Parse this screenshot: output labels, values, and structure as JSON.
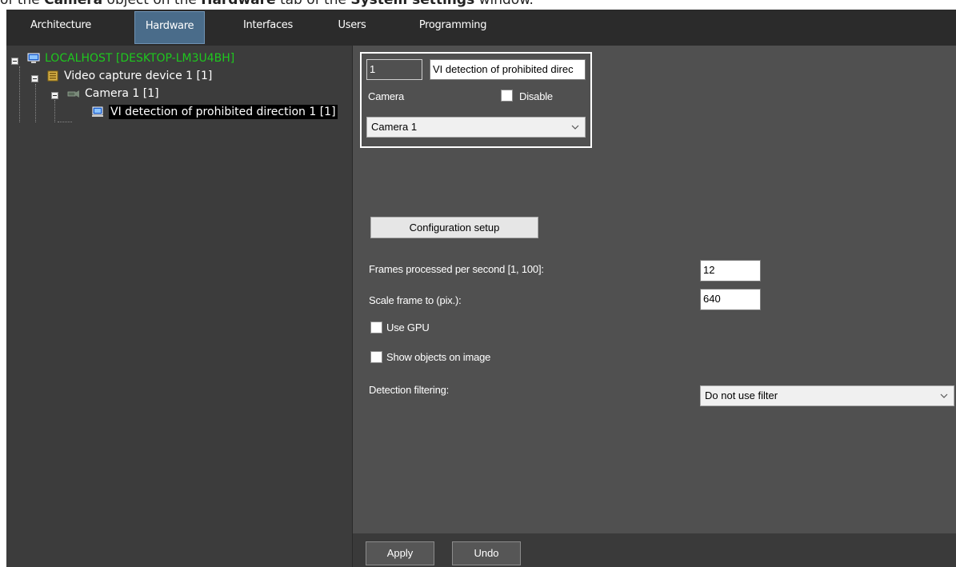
{
  "caption": {
    "part1": "of the ",
    "bold1": "Camera",
    "part2": " object on the ",
    "bold2": "Hardware",
    "part3": " tab of the ",
    "bold3": "System settings",
    "part4": " window."
  },
  "tabs": [
    {
      "label": "Architecture",
      "active": false
    },
    {
      "label": "Hardware",
      "active": true
    },
    {
      "label": "Interfaces",
      "active": false
    },
    {
      "label": "Users",
      "active": false
    },
    {
      "label": "Programming",
      "active": false
    }
  ],
  "tree": {
    "nodes": [
      {
        "label": "LOCALHOST [DESKTOP-LM3U4BH]",
        "icon": "computer-icon",
        "color": "#1ec81e"
      },
      {
        "label": "Video capture device 1 [1]",
        "icon": "capture-device-icon"
      },
      {
        "label": "Camera 1 [1]",
        "icon": "camera-icon"
      },
      {
        "label": "VI detection of prohibited direction 1 [1]",
        "icon": "detector-icon",
        "selected": true
      }
    ]
  },
  "object": {
    "id_value": "1",
    "name_value": "VI detection of prohibited direc",
    "camera_label": "Camera",
    "disable_label": "Disable",
    "disable_checked": false,
    "camera_selected": "Camera 1"
  },
  "config_button": "Configuration setup",
  "fields": {
    "fps_label": "Frames processed per second [1, 100]:",
    "fps_value": "12",
    "scale_label": "Scale frame to (pix.):",
    "scale_value": "640",
    "use_gpu_label": "Use GPU",
    "use_gpu_checked": false,
    "show_objects_label": "Show objects on image",
    "show_objects_checked": false,
    "filter_label": "Detection filtering:",
    "filter_value": "Do not use filter"
  },
  "footer": {
    "apply": "Apply",
    "undo": "Undo"
  },
  "colors": {
    "tabbar": "#2b2b2b",
    "active_tab": "#4a6c8a",
    "tree_bg": "#3c3c3c",
    "panel_bg": "#505050",
    "localhost_green": "#1ec81e"
  }
}
